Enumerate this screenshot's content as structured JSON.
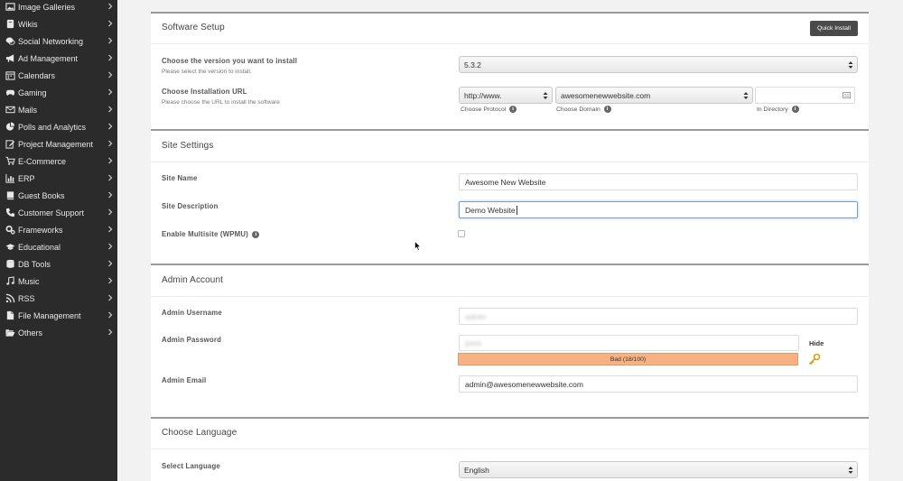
{
  "sidebar": {
    "items": [
      {
        "label": "Image Galleries",
        "icon": "image-icon"
      },
      {
        "label": "Wikis",
        "icon": "wiki-icon"
      },
      {
        "label": "Social Networking",
        "icon": "comments-icon"
      },
      {
        "label": "Ad Management",
        "icon": "bullhorn-icon"
      },
      {
        "label": "Calendars",
        "icon": "calendar-icon"
      },
      {
        "label": "Gaming",
        "icon": "gamepad-icon"
      },
      {
        "label": "Mails",
        "icon": "envelope-icon"
      },
      {
        "label": "Polls and Analytics",
        "icon": "pie-chart-icon"
      },
      {
        "label": "Project Management",
        "icon": "edit-icon"
      },
      {
        "label": "E-Commerce",
        "icon": "cart-icon"
      },
      {
        "label": "ERP",
        "icon": "bar-chart-icon"
      },
      {
        "label": "Guest Books",
        "icon": "book-icon"
      },
      {
        "label": "Customer Support",
        "icon": "phone-icon"
      },
      {
        "label": "Frameworks",
        "icon": "cogs-icon"
      },
      {
        "label": "Educational",
        "icon": "graduation-cap-icon"
      },
      {
        "label": "DB Tools",
        "icon": "database-icon"
      },
      {
        "label": "Music",
        "icon": "music-icon"
      },
      {
        "label": "RSS",
        "icon": "rss-icon"
      },
      {
        "label": "File Management",
        "icon": "file-icon"
      },
      {
        "label": "Others",
        "icon": "folder-open-icon"
      }
    ]
  },
  "software_setup": {
    "title": "Software Setup",
    "quick_install_label": "Quick Install",
    "version_label": "Choose the version you want to install",
    "version_sublabel": "Please select the version to install.",
    "version_value": "5.3.2",
    "url_label": "Choose Installation URL",
    "url_sublabel": "Please choose the URL to install the software",
    "protocol_value": "http://www.",
    "domain_value": "awesomenewwebsite.com",
    "directory_value": "",
    "protocol_caption": "Choose Protocol",
    "domain_caption": "Choose Domain",
    "directory_caption": "In Directory"
  },
  "site_settings": {
    "title": "Site Settings",
    "site_name_label": "Site Name",
    "site_name_value": "Awesome New Website",
    "site_desc_label": "Site Description",
    "site_desc_value": "Demo Website",
    "multisite_label": "Enable Multisite (WPMU)",
    "multisite_checked": false
  },
  "admin_account": {
    "title": "Admin Account",
    "username_label": "Admin Username",
    "username_value": "admin",
    "password_label": "Admin Password",
    "password_value": "pass",
    "strength_text": "Bad (18/100)",
    "strength_color": "#f7b183",
    "hide_label": "Hide",
    "email_label": "Admin Email",
    "email_value": "admin@awesomenewwebsite.com"
  },
  "language": {
    "title": "Choose Language",
    "select_label": "Select Language",
    "select_value": "English"
  }
}
